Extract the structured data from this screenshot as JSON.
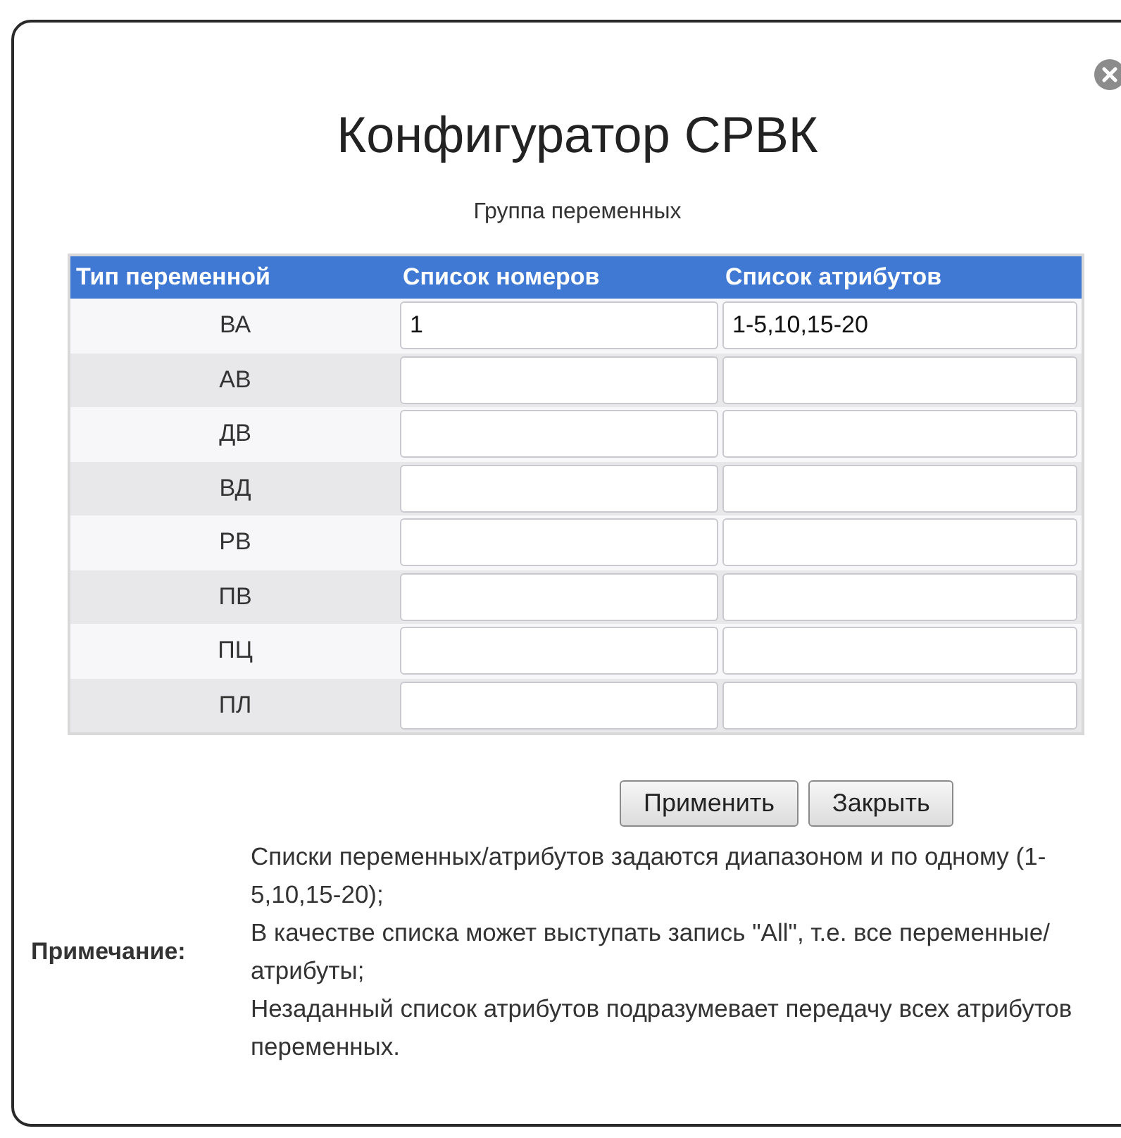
{
  "dialog": {
    "title": "Конфигуратор СРВК",
    "subtitle": "Группа переменных"
  },
  "table": {
    "columns": [
      "Тип переменной",
      "Список номеров",
      "Список атрибутов"
    ],
    "rows": [
      {
        "type": "ВА",
        "numbers": "1",
        "attributes": "1-5,10,15-20"
      },
      {
        "type": "АВ"
      },
      {
        "type": "ДВ"
      },
      {
        "type": "ВД"
      },
      {
        "type": "РВ"
      },
      {
        "type": "ПВ"
      },
      {
        "type": "ПЦ"
      },
      {
        "type": "ПЛ"
      }
    ]
  },
  "buttons": [
    "Применить",
    "Закрыть"
  ],
  "note": {
    "label": "Примечание:",
    "lines": [
      "Списки переменных/атрибутов задаются диапазоном и по одному (1-5,10,15-20);",
      "В качестве списка может выступать запись \"All\", т.е. все переменные/атрибуты;",
      "Незаданный список атрибутов подразумевает передачу всех атрибутов переменных."
    ]
  }
}
